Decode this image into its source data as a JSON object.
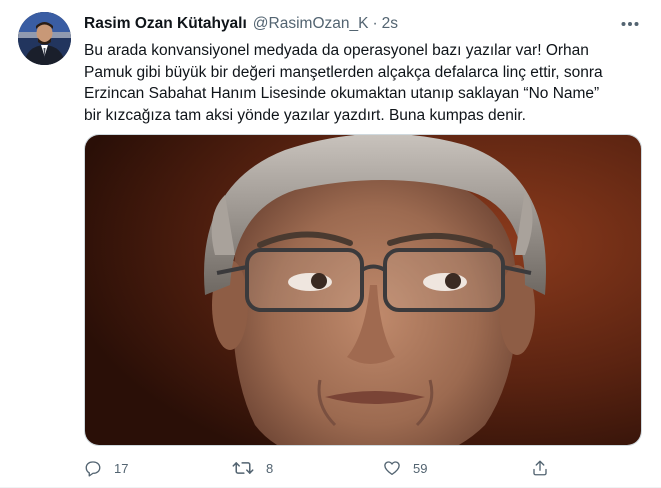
{
  "tweet": {
    "author": {
      "display_name": "Rasim Ozan Kütahyalı",
      "handle": "@RasimOzan_K",
      "separator": "·",
      "time": "2s"
    },
    "text_lines": [
      "Bu arada konvansiyonel medyada da operasyonel bazı yazılar var! Orhan",
      "Pamuk gibi büyük bir değeri manşetlerden alçakça defalarca linç ettir, sonra",
      "Erzincan Sabahat Hanım Lisesinde okumaktan utanıp saklayan “No Name”",
      "bir kızcağıza tam aksi yönde yazılar yazdırt. Buna kumpas denir."
    ],
    "media": {
      "type": "photo",
      "subject": "close-up portrait of a man with grey hair and rimmed glasses"
    },
    "actions": {
      "reply": {
        "icon": "reply-icon",
        "count": "17"
      },
      "retweet": {
        "icon": "retweet-icon",
        "count": "8"
      },
      "like": {
        "icon": "heart-icon",
        "count": "59"
      },
      "share": {
        "icon": "share-icon"
      }
    },
    "more_icon": "more-icon"
  },
  "colors": {
    "text_primary": "#0f1419",
    "text_secondary": "#536471",
    "border": "#cfd9de"
  }
}
